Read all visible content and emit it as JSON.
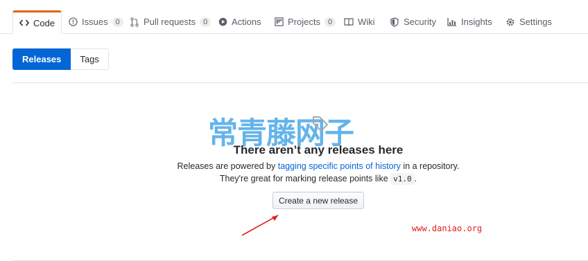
{
  "tabs": [
    {
      "label": "Code",
      "icon": "code-icon",
      "selected": true
    },
    {
      "label": "Issues",
      "icon": "issue-opened-icon",
      "count": "0"
    },
    {
      "label": "Pull requests",
      "icon": "git-pull-request-icon",
      "count": "0"
    },
    {
      "label": "Actions",
      "icon": "play-icon"
    },
    {
      "label": "Projects",
      "icon": "project-icon",
      "count": "0"
    },
    {
      "label": "Wiki",
      "icon": "book-icon"
    },
    {
      "label": "Security",
      "icon": "shield-icon"
    },
    {
      "label": "Insights",
      "icon": "graph-icon"
    },
    {
      "label": "Settings",
      "icon": "gear-icon"
    }
  ],
  "subnav": {
    "releases": "Releases",
    "tags": "Tags"
  },
  "blankslate": {
    "title": "There aren’t any releases here",
    "line1_prefix": "Releases are powered by ",
    "line1_link": "tagging specific points of history",
    "line1_suffix": " in a repository.",
    "line2_prefix": "They're great for marking release points like ",
    "line2_code": "v1.0",
    "line2_suffix": ".",
    "button": "Create a new release"
  },
  "watermark": {
    "chinese": "常青藤网子",
    "url": "www.daniao.org"
  },
  "colors": {
    "accent": "#0366d6",
    "tab_active": "#e36209",
    "watermark_blue": "#4aa7e8",
    "watermark_red": "#e02020"
  }
}
